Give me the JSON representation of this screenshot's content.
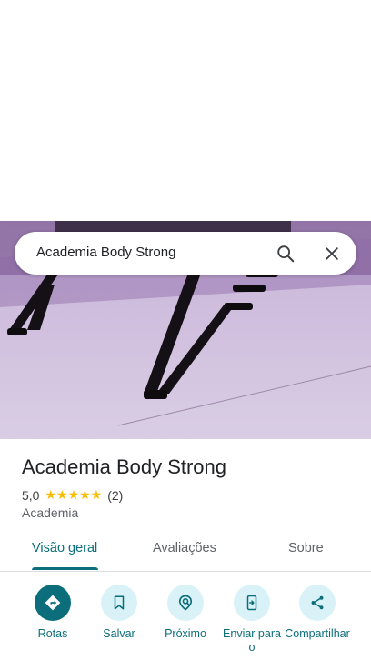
{
  "search": {
    "query": "Academia Body Strong"
  },
  "place": {
    "name": "Academia Body Strong",
    "rating": "5,0",
    "stars": "★★★★★",
    "reviews": "(2)",
    "category": "Academia"
  },
  "tabs": [
    {
      "label": "Visão geral",
      "active": true
    },
    {
      "label": "Avaliações",
      "active": false
    },
    {
      "label": "Sobre",
      "active": false
    }
  ],
  "actions": [
    {
      "label": "Rotas",
      "icon": "directions-icon"
    },
    {
      "label": "Salvar",
      "icon": "bookmark-icon"
    },
    {
      "label": "Próximo",
      "icon": "nearby-icon"
    },
    {
      "label": "Enviar para o",
      "icon": "send-to-phone-icon"
    },
    {
      "label": "Compartilhar",
      "icon": "share-icon"
    }
  ],
  "colors": {
    "accent": "#0b6e7a",
    "accent_light": "#d9f2f7",
    "star": "#fbbc04"
  }
}
